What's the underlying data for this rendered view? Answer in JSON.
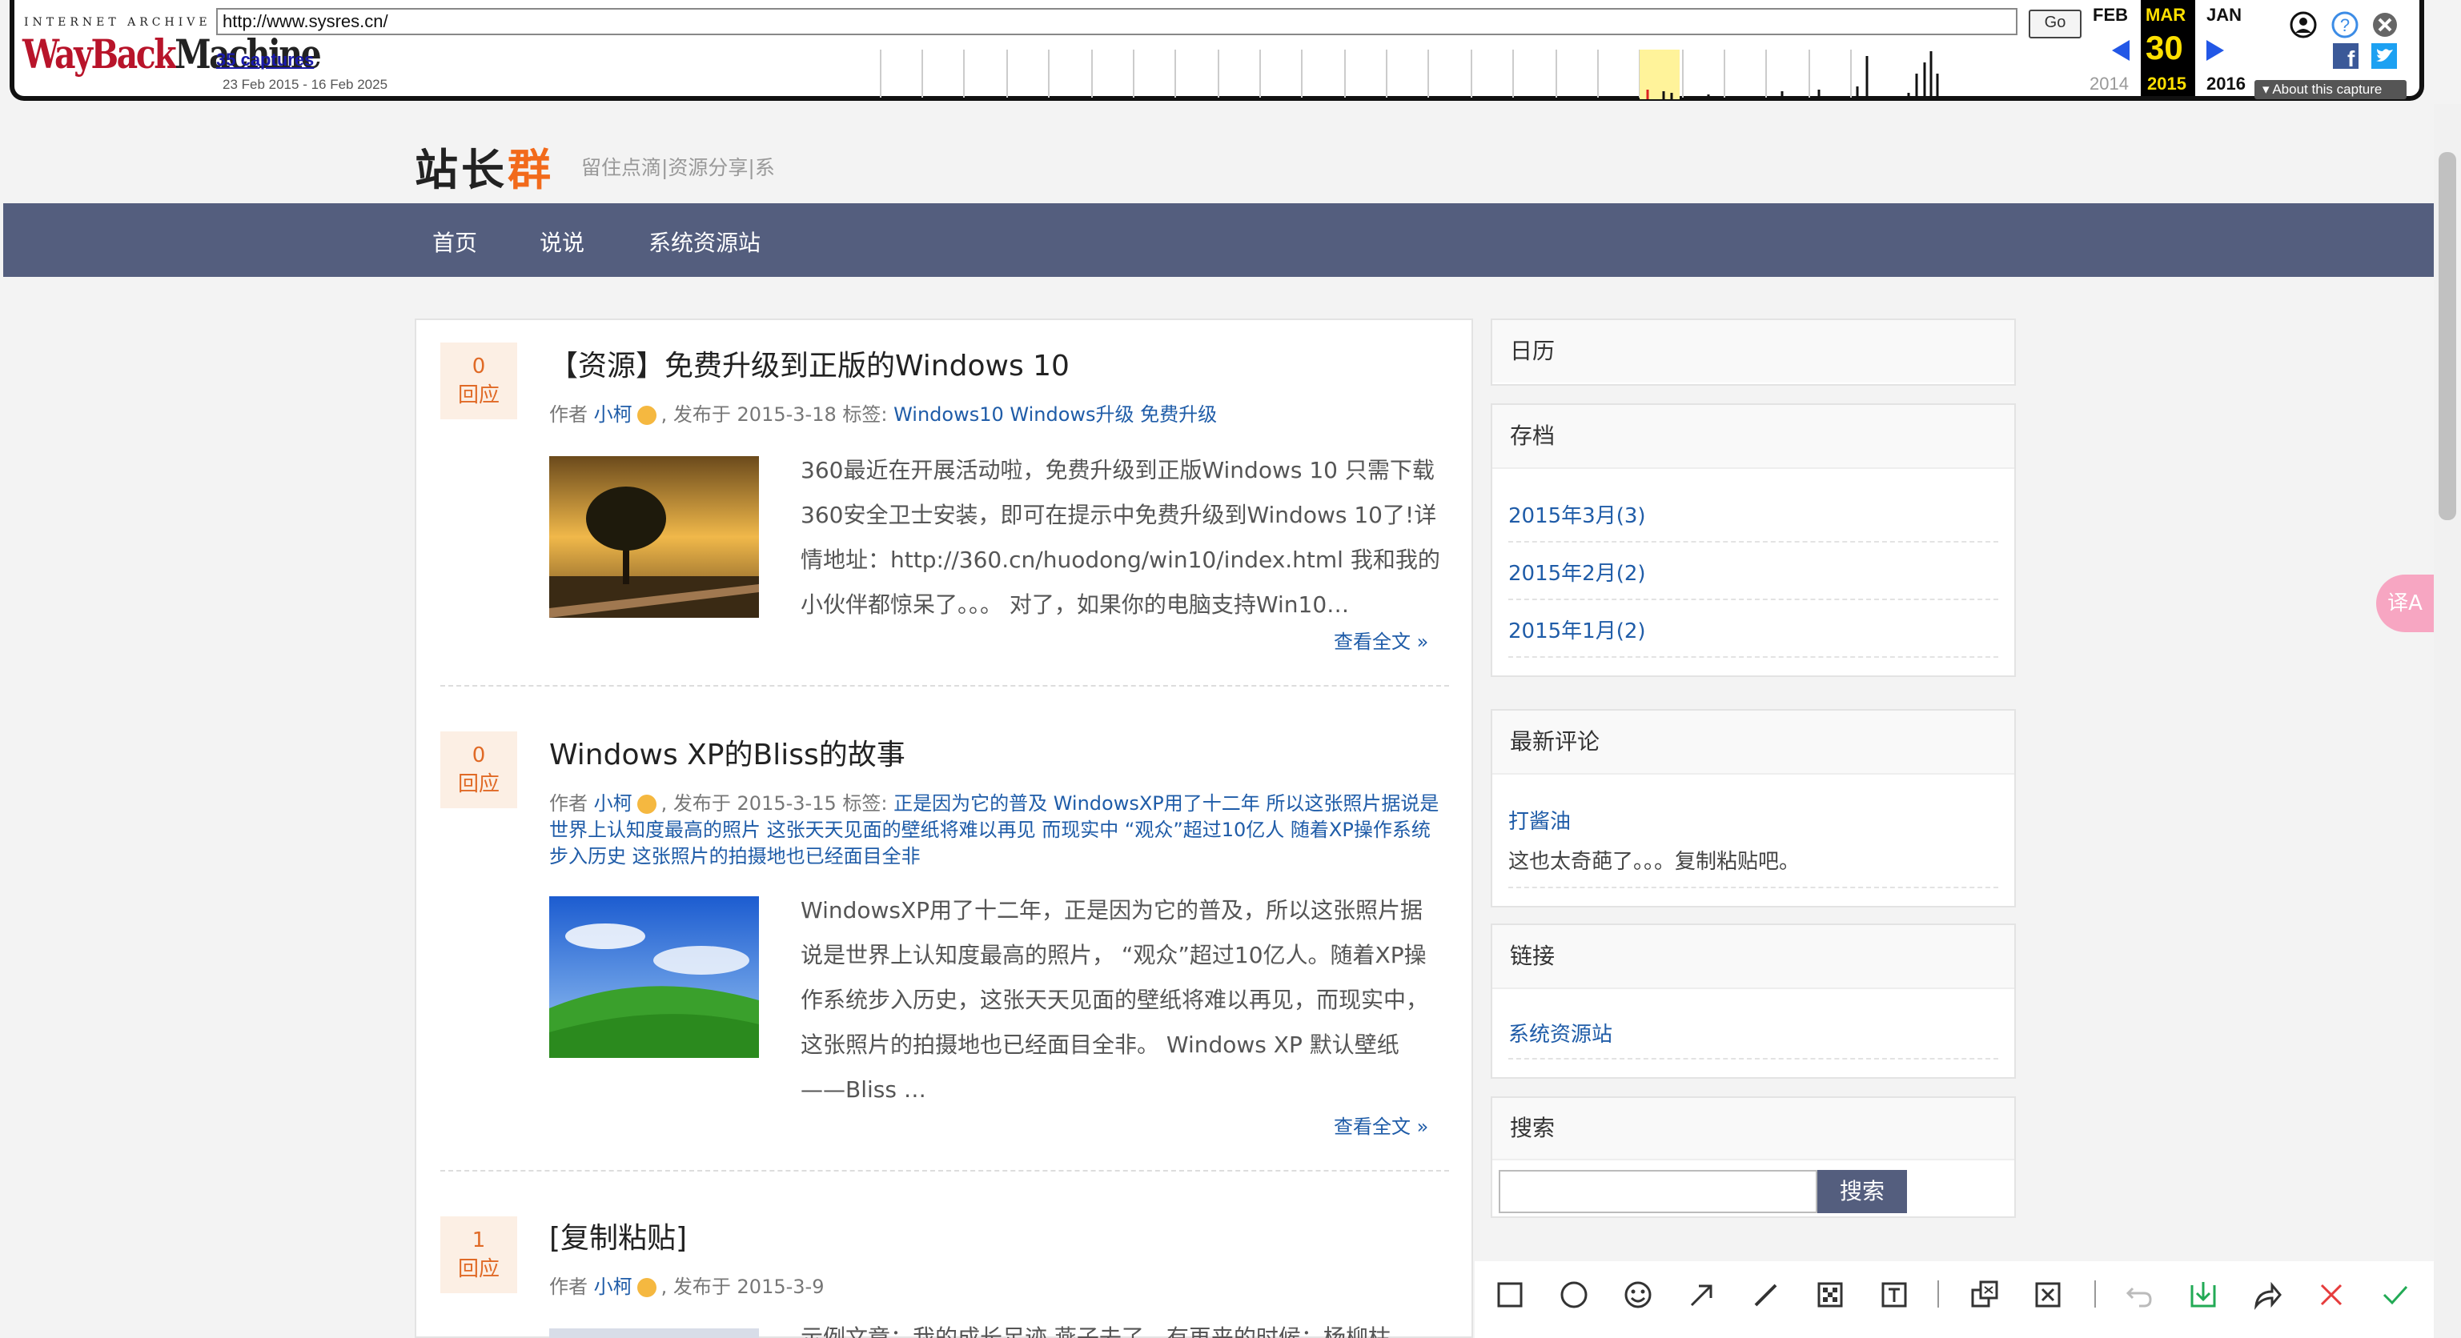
{
  "wayback": {
    "logo_top": "INTERNET ARCHIVE",
    "logo_main": "WayBack",
    "logo_machine": "Machine",
    "url": "http://www.sysres.cn/",
    "go_label": "Go",
    "captures": "35 captures",
    "date_range": "23 Feb 2015 - 16 Feb 2025",
    "prev_month": "FEB",
    "current_month": "MAR",
    "next_month": "JAN",
    "current_day": "30",
    "prev_year": "2014",
    "current_year": "2015",
    "next_year": "2016",
    "about_capture": "About this capture"
  },
  "site": {
    "logo_main": "站长",
    "logo_accent": "群",
    "tagline": "留住点滴|资源分享|系",
    "nav": [
      "首页",
      "说说",
      "系统资源站"
    ]
  },
  "posts": [
    {
      "count": "0",
      "count_label": "回应",
      "title": "【资源】免费升级到正版的Windows 10",
      "meta_author_prefix": "作者",
      "author": "小柯",
      "meta_date": ", 发布于 2015-3-18 标签:",
      "tags": "Windows10 Windows升级 免费升级",
      "excerpt": "360最近在开展活动啦，免费升级到正版Windows 10 只需下载360安全卫士安装，即可在提示中免费升级到Windows 10了!详情地址：http://360.cn/huodong/win10/index.html 我和我的小伙伴都惊呆了。。。 对了，如果你的电脑支持Win10…",
      "more": "查看全文 »"
    },
    {
      "count": "0",
      "count_label": "回应",
      "title": "Windows XP的Bliss的故事",
      "meta_author_prefix": "作者",
      "author": "小柯",
      "meta_date": ", 发布于 2015-3-15 标签:",
      "tags": "正是因为它的普及 WindowsXP用了十二年 所以这张照片据说是世界上认知度最高的照片 这张天天见面的壁纸将难以再见 而现实中 “观众”超过10亿人 随着XP操作系统步入历史 这张照片的拍摄地也已经面目全非",
      "excerpt": "WindowsXP用了十二年，正是因为它的普及，所以这张照片据说是世界上认知度最高的照片， “观众”超过10亿人。随着XP操作系统步入历史，这张天天见面的壁纸将难以再见，而现实中，这张照片的拍摄地也已经面目全非。 Windows XP 默认壁纸——Bliss …",
      "more": "查看全文 »"
    },
    {
      "count": "1",
      "count_label": "回应",
      "title": "[复制粘贴]",
      "meta_author_prefix": "作者",
      "author": "小柯",
      "meta_date": ", 发布于 2015-3-9",
      "excerpt_partial": "示例文章：我的成长足迹 燕子去了，有再来的时候；杨柳枯"
    }
  ],
  "sidebar": {
    "calendar_title": "日历",
    "archive_title": "存档",
    "archives": [
      "2015年3月(3)",
      "2015年2月(2)",
      "2015年1月(2)"
    ],
    "comments_title": "最新评论",
    "comment_author": "打酱油",
    "comment_text": "这也太奇葩了。。。复制粘贴吧。",
    "links_title": "链接",
    "links": [
      "系统资源站"
    ],
    "search_title": "搜索",
    "search_button": "搜索"
  },
  "translate_label": "译A",
  "colors": {
    "nav": "#545e7e",
    "accent": "#f26a1b",
    "link": "#1f5ca8",
    "wayback_highlight": "#ffe000"
  },
  "annotation_toolbar": [
    "rectangle-icon",
    "ellipse-icon",
    "emoji-icon",
    "arrow-icon",
    "pen-icon",
    "mosaic-icon",
    "text-icon",
    "ocr-icon",
    "translate-icon",
    "undo-icon",
    "download-icon",
    "share-icon",
    "close-icon",
    "confirm-icon"
  ]
}
